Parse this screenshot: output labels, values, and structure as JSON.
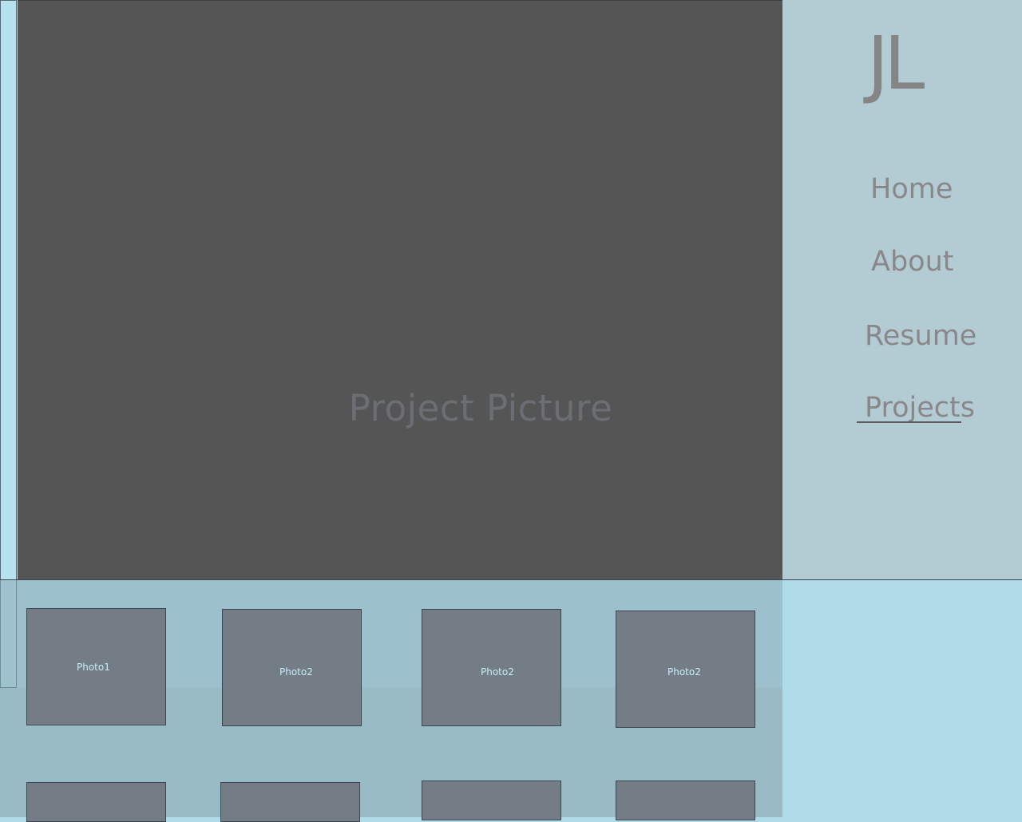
{
  "hero": {
    "caption": "Project Picture"
  },
  "sidebar": {
    "logo": "JL",
    "nav": {
      "home": "Home",
      "about": "About",
      "resume": "Resume",
      "projects": "Projects"
    },
    "active_item": "Projects"
  },
  "gallery": {
    "photos": [
      "Photo1",
      "Photo2",
      "Photo2",
      "Photo2"
    ]
  },
  "colors": {
    "page_background": "#b0dbe8",
    "hero_background": "#555555",
    "sidebar_background": "#b3ccd4",
    "thumbnail_fill": "#747c86",
    "thumbnail_label": "#c4eef8",
    "nav_text": "#8a878a"
  }
}
